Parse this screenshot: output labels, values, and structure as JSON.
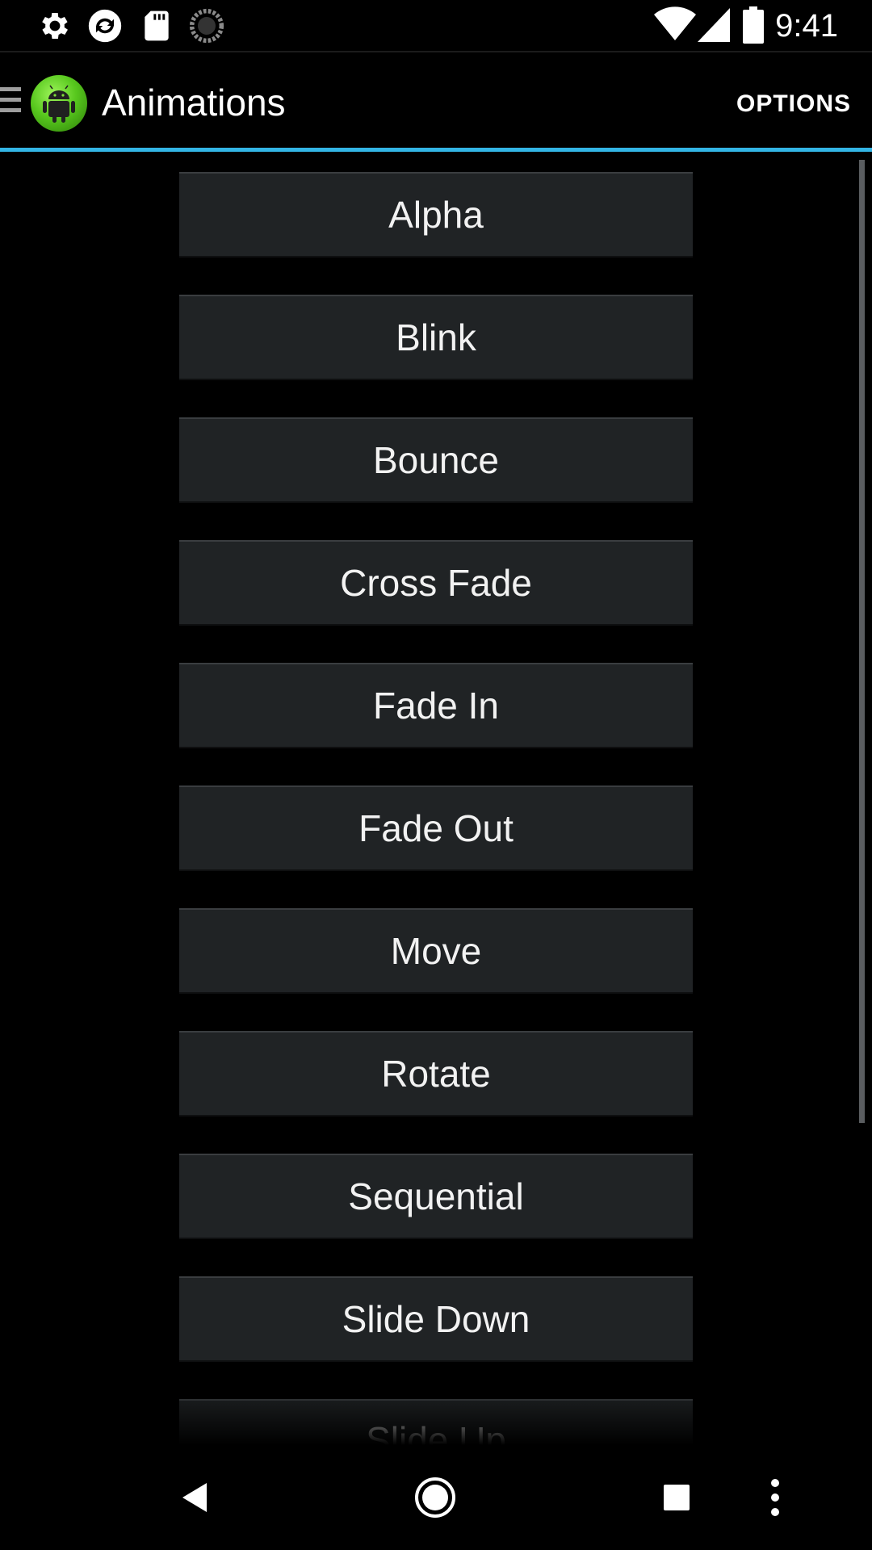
{
  "status_bar": {
    "time": "9:41",
    "left_icons": [
      "settings-icon",
      "sync-icon",
      "sd-card-icon",
      "loading-icon"
    ],
    "right_icons": [
      "wifi-icon",
      "cell-signal-icon",
      "battery-icon"
    ]
  },
  "action_bar": {
    "title": "Animations",
    "options_label": "OPTIONS",
    "accent_color": "#33b5e5"
  },
  "buttons": [
    {
      "label": "Alpha"
    },
    {
      "label": "Blink"
    },
    {
      "label": "Bounce"
    },
    {
      "label": "Cross Fade"
    },
    {
      "label": "Fade In"
    },
    {
      "label": "Fade Out"
    },
    {
      "label": "Move"
    },
    {
      "label": "Rotate"
    },
    {
      "label": "Sequential"
    },
    {
      "label": "Slide Down"
    },
    {
      "label": "Slide Up"
    }
  ],
  "nav_bar": {
    "icons": [
      "back-icon",
      "home-icon",
      "recents-icon",
      "more-icon"
    ]
  }
}
